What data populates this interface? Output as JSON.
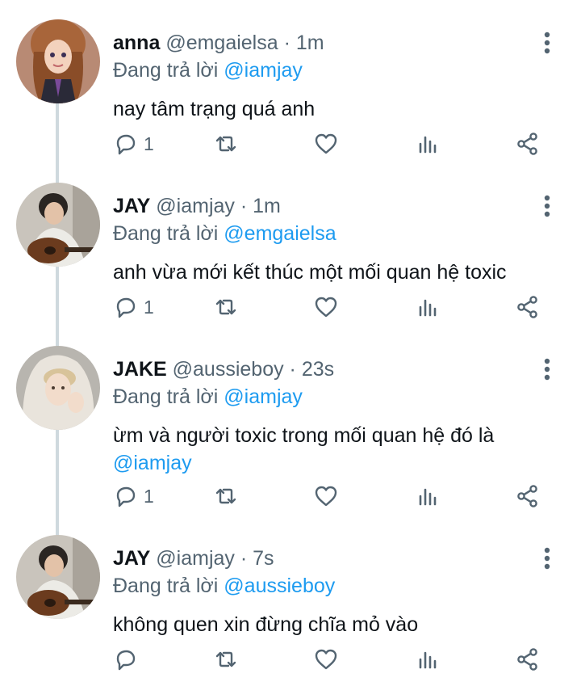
{
  "tweets": [
    {
      "name": "anna",
      "handle": "@emgaielsa",
      "time": "1m",
      "replying_prefix": "Đang trả lời",
      "replying_to": "@iamjay",
      "text": "nay tâm trạng quá anh",
      "text_mention": "",
      "reply_count": "1",
      "avatar": "anna-avatar"
    },
    {
      "name": "JAY",
      "handle": "@iamjay",
      "time": "1m",
      "replying_prefix": "Đang trả lời",
      "replying_to": "@emgaielsa",
      "text": "anh vừa mới kết thúc một mối quan hệ toxic",
      "text_mention": "",
      "reply_count": "1",
      "avatar": "jay-avatar"
    },
    {
      "name": "JAKE",
      "handle": "@aussieboy",
      "time": "23s",
      "replying_prefix": "Đang trả lời",
      "replying_to": "@iamjay",
      "text": "ừm và người toxic trong mối quan hệ đó là",
      "text_mention": "@iamjay",
      "reply_count": "1",
      "avatar": "jake-avatar"
    },
    {
      "name": "JAY",
      "handle": "@iamjay",
      "time": "7s",
      "replying_prefix": "Đang trả lời",
      "replying_to": "@aussieboy",
      "text": "không quen xin đừng chĩa mỏ vào",
      "text_mention": "",
      "reply_count": "",
      "avatar": "jay-avatar"
    }
  ],
  "separator": "·",
  "icons": [
    "reply-icon",
    "retweet-icon",
    "like-icon",
    "analytics-icon",
    "share-icon",
    "more-icon"
  ],
  "colors": {
    "mention": "#1d9bf0",
    "secondary_text": "#536471",
    "thread_line": "#cfd9de"
  }
}
